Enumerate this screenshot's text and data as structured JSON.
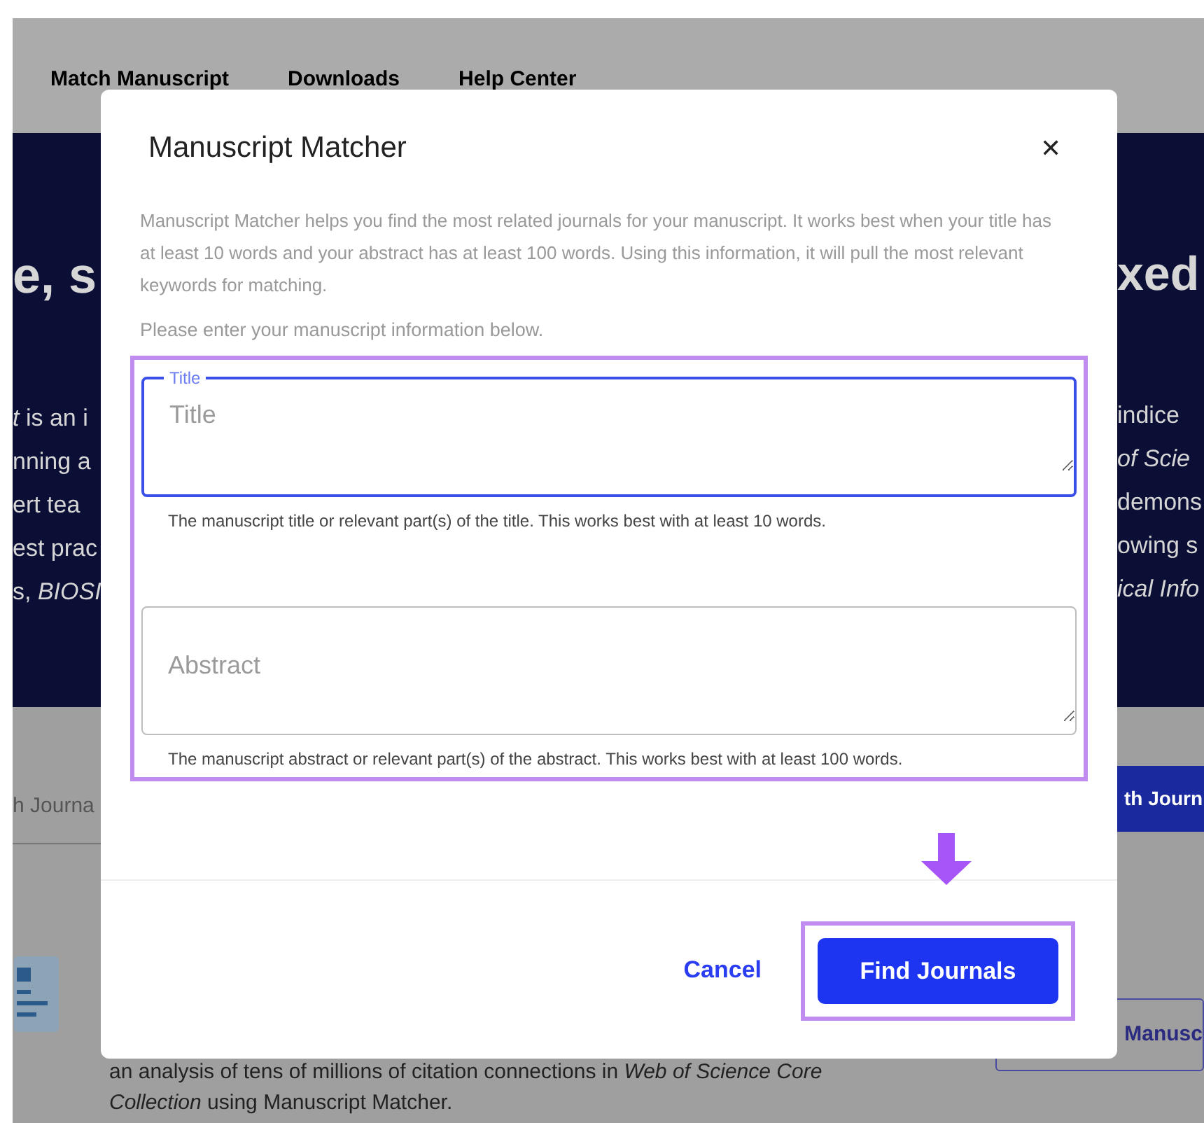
{
  "background_page": {
    "nav": [
      "Match Manuscript",
      "Downloads",
      "Help Center"
    ],
    "hero": {
      "headline_left": "e, s",
      "headline_right": "xed",
      "lines_left": [
        "*t* is an i",
        "nning a",
        "ert tea",
        "est prac",
        "s, *BIOSI*"
      ],
      "lines_right": [
        "indice",
        "*of Scie*",
        "demons",
        "owing s",
        "*ical Info*"
      ]
    },
    "search_field": {
      "value": "h Journa"
    },
    "search_button": "th Journ",
    "outline_button": "Manusc",
    "body_text": "an analysis of tens of millions of citation connections in  *Web of Science Core Collection* using Manuscript Matcher."
  },
  "dialog": {
    "title": "Manuscript Matcher",
    "close": "✕",
    "description": "Manuscript Matcher helps you find the most related journals for your manuscript. It works best when your title has at least 10 words and your abstract has at least 100 words. Using this information, it will pull the most relevant keywords for matching.",
    "prompt": "Please enter your manuscript information below.",
    "fields": [
      {
        "label": "Title",
        "placeholder": "Title",
        "focused": true,
        "helper": "The manuscript title or relevant part(s) of the title. This works best with at least 10 words."
      },
      {
        "placeholder": "Abstract",
        "focused": false,
        "helper": "The manuscript abstract or relevant part(s) of the abstract. This works best with at least 100 words."
      }
    ],
    "buttons": [
      {
        "kind": "link",
        "label": "Cancel"
      },
      {
        "kind": "primary",
        "label": "Find Journals"
      }
    ]
  }
}
